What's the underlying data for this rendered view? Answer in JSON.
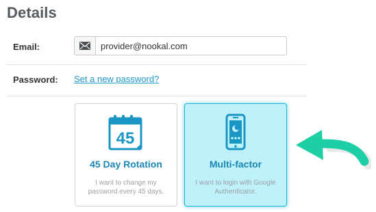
{
  "section": {
    "title": "Details"
  },
  "email": {
    "label": "Email:",
    "value": "provider@nookal.com",
    "icon": "envelope-icon"
  },
  "password": {
    "label": "Password:",
    "link_text": "Set a new password?"
  },
  "options": [
    {
      "title": "45 Day Rotation",
      "calendar_number": "45",
      "description": "I want to change my password every 45 days.",
      "icon": "calendar-icon",
      "selected": false
    },
    {
      "title": "Multi-factor",
      "description": "I want to login with Google Authenticator.",
      "icon": "phone-icon",
      "selected": true
    }
  ],
  "colors": {
    "accent": "#1e96c8",
    "card_title": "#1a86b5",
    "selected_bg": "#bff1fb",
    "selected_border": "#1fb8d6",
    "arrow": "#1ecfa5"
  },
  "annotation_icon": "arrow-pointer-icon"
}
